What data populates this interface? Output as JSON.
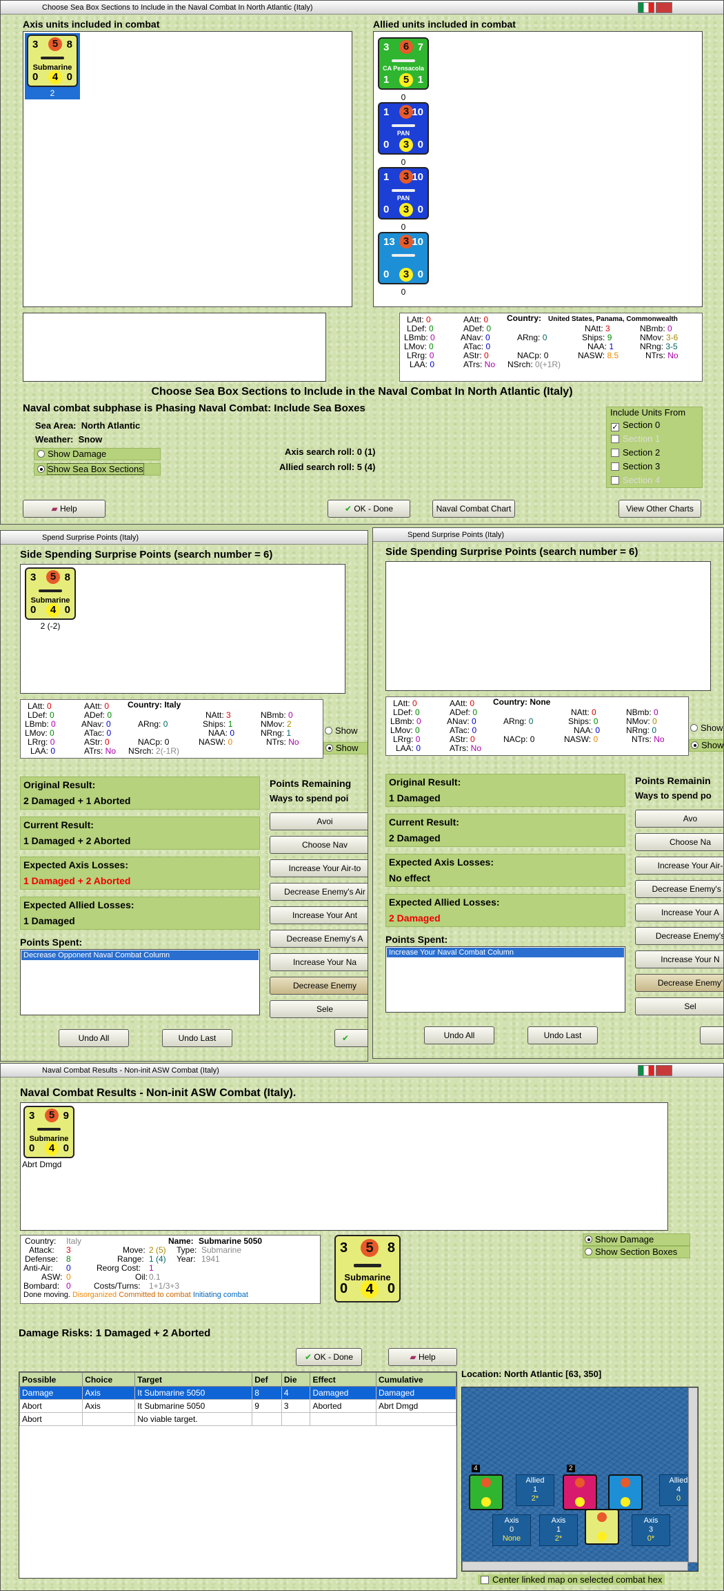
{
  "sea_box_window": {
    "title": "Choose Sea Box Sections to Include in the Naval Combat In North Atlantic (Italy)",
    "axis_units_label": "Axis units included in combat",
    "allied_units_label": "Allied units included in combat",
    "axis_unit": {
      "tl": "3",
      "tm": "5",
      "tr": "8",
      "name": "Submarine",
      "bl": "0",
      "bm": "4",
      "br": "0",
      "below": "2"
    },
    "allied_units": [
      {
        "tl": "3",
        "tm": "6",
        "tr": "7",
        "name": "CA Pensacola",
        "bl": "1",
        "bm": "5",
        "br": "1",
        "below": "0",
        "color": "#2fb52f"
      },
      {
        "tl": "1",
        "tm": "3",
        "tr": "10",
        "name": "PAN",
        "bl": "0",
        "bm": "3",
        "br": "0",
        "below": "0",
        "color": "#1c3fd6"
      },
      {
        "tl": "1",
        "tm": "3",
        "tr": "10",
        "name": "PAN",
        "bl": "0",
        "bm": "3",
        "br": "0",
        "below": "0",
        "color": "#1c3fd6"
      },
      {
        "tl": "13",
        "tm": "3",
        "tr": "10",
        "name": "",
        "bl": "0",
        "bm": "3",
        "br": "0",
        "below": "0",
        "color": "#1d8fd6"
      }
    ],
    "stats": {
      "latt": "0",
      "aatt": "0",
      "ldef": "0",
      "adef": "0",
      "lbmb": "0",
      "anav": "0",
      "lmov": "0",
      "atac": "0",
      "lrg": "0",
      "astr": "0",
      "laa": "0",
      "atrs": "No",
      "country_label": "Country:",
      "country": "United States, Panama, Commonwealth",
      "arng": "0",
      "nacp": "0",
      "nsrch": "0(+1R)",
      "natt": "3",
      "nbmb": "0",
      "ships": "9",
      "nmov": "3-6",
      "naa": "1",
      "nrng": "3-5",
      "nasw": "8.5",
      "ntrs": "No"
    },
    "heading": "Choose Sea Box Sections to Include in the Naval Combat In North Atlantic (Italy)",
    "subphase": "Naval combat subphase is Phasing Naval Combat: Include Sea Boxes",
    "sea_area_label": "Sea Area:",
    "sea_area": "North Atlantic",
    "weather_label": "Weather:",
    "weather": "Snow",
    "show_damage": "Show Damage",
    "show_sections": "Show Sea Box Sections",
    "axis_search": "Axis search roll: 0 (1)",
    "allied_search": "Allied search roll: 5 (4)",
    "include_from": "Include Units From",
    "sections": [
      "Section 0",
      "Section 1",
      "Section 2",
      "Section 3",
      "Section 4"
    ],
    "help": "Help",
    "ok": "OK - Done",
    "chart": "Naval Combat Chart",
    "other": "View Other Charts"
  },
  "surprise_left": {
    "title": "Spend Surprise Points (Italy)",
    "header": "Side Spending Surprise Points (search number = 6)",
    "unit": {
      "tl": "3",
      "tm": "5",
      "tr": "8",
      "name": "Submarine",
      "bl": "0",
      "bm": "4",
      "br": "0",
      "below": "2 (-2)"
    },
    "stats": {
      "latt": "0",
      "aatt": "0",
      "country_label": "Country:",
      "country": "Italy",
      "natt": "3",
      "nbmb": "0",
      "ldef": "0",
      "adef": "0",
      "ships": "1",
      "nmov": "2",
      "lbmb": "0",
      "anav": "0",
      "arng": "0",
      "naa": "0",
      "nrng": "1",
      "lmov": "0",
      "atac": "0",
      "nasw": "0",
      "ntrs": "No",
      "lrg": "0",
      "astr": "0",
      "nacp": "0",
      "laa": "0",
      "atrs": "No",
      "nsrch": "2(-1R)"
    },
    "orig_h": "Original Result:",
    "orig_v": "2 Damaged + 1 Aborted",
    "cur_h": "Current Result:",
    "cur_v": "1 Damaged + 2 Aborted",
    "axis_h": "Expected Axis Losses:",
    "axis_v": "1 Damaged + 2 Aborted",
    "allied_h": "Expected Allied Losses:",
    "allied_v": "1 Damaged",
    "spent_h": "Points Spent:",
    "spent_item": "Decrease Opponent Naval Combat Column",
    "remaining": "Points Remaining",
    "ways": "Ways to spend poi",
    "buttons": [
      "Avoi",
      "Choose Nav",
      "Increase Your Air-to",
      "Decrease Enemy's Air",
      "Increase Your Ant",
      "Decrease Enemy's A",
      "Increase Your Na",
      "Decrease Enemy",
      "Sele"
    ],
    "show1": "Show",
    "show2": "Show",
    "undo_all": "Undo All",
    "undo_last": "Undo Last"
  },
  "surprise_right": {
    "title": "Spend Surprise Points (Italy)",
    "header": "Side Spending Surprise Points (search number = 6)",
    "stats": {
      "latt": "0",
      "aatt": "0",
      "country_label": "Country:",
      "country": "None",
      "natt": "0",
      "nbmb": "0",
      "ldef": "0",
      "adef": "0",
      "ships": "0",
      "nmov": "0",
      "lbmb": "0",
      "anav": "0",
      "arng": "0",
      "naa": "0",
      "nrng": "0",
      "lmov": "0",
      "atac": "0",
      "nasw": "0",
      "ntrs": "No",
      "lrg": "0",
      "astr": "0",
      "nacp": "0",
      "laa": "0",
      "atrs": "No"
    },
    "orig_h": "Original Result:",
    "orig_v": "1 Damaged",
    "cur_h": "Current Result:",
    "cur_v": "2 Damaged",
    "axis_h": "Expected Axis Losses:",
    "axis_v": "No effect",
    "allied_h": "Expected Allied Losses:",
    "allied_v": "2 Damaged",
    "spent_h": "Points Spent:",
    "spent_item": "Increase Your Naval Combat Column",
    "remaining": "Points Remainin",
    "ways": "Ways to spend po",
    "buttons": [
      "Avo",
      "Choose Na",
      "Increase Your Air-",
      "Decrease Enemy's A",
      "Increase Your A",
      "Decrease Enemy's",
      "Increase Your N",
      "Decrease Enemy'",
      "Sel"
    ],
    "show1": "Show",
    "show2": "Show",
    "undo_all": "Undo All",
    "undo_last": "Undo Last"
  },
  "results_window": {
    "title": "Naval Combat Results - Non-init ASW Combat (Italy)",
    "heading": "Naval Combat Results - Non-init ASW Combat (Italy).",
    "unit": {
      "tl": "3",
      "tm": "5",
      "tr": "9",
      "name": "Submarine",
      "bl": "0",
      "bm": "4",
      "br": "0",
      "below": "Abrt Dmgd"
    },
    "big_unit": {
      "tl": "3",
      "tm": "5",
      "tr": "8",
      "name": "Submarine",
      "bl": "0",
      "bm": "4",
      "br": "0"
    },
    "info": {
      "country_l": "Country:",
      "country": "Italy",
      "attack_l": "Attack:",
      "attack": "3",
      "defense_l": "Defense:",
      "defense": "8",
      "antiair_l": "Anti-Air:",
      "antiair": "0",
      "asw_l": "ASW:",
      "asw": "0",
      "bombard_l": "Bombard:",
      "bombard": "0",
      "name_l": "Name:",
      "name": "Submarine 5050",
      "move_l": "Move:",
      "move": "2 (5)",
      "type_l": "Type:",
      "type": "Submarine",
      "range_l": "Range:",
      "range": "1 (4)",
      "year_l": "Year:",
      "year": "1941",
      "reorg_l": "Reorg Cost:",
      "reorg": "1",
      "oil_l": "Oil:",
      "oil": "0.1",
      "costs_l": "Costs/Turns:",
      "costs": "1+1/3+3",
      "status1": "Done moving.",
      "status2": "Disorganized",
      "status3": "Committed to combat",
      "status4": "Initiating combat"
    },
    "show_damage": "Show Damage",
    "show_sections": "Show Section Boxes",
    "risks": "Damage Risks:  1 Damaged + 2 Aborted",
    "ok": "OK - Done",
    "help": "Help",
    "table_headers": [
      "Possible",
      "Choice",
      "Target",
      "Def",
      "Die",
      "Effect",
      "Cumulative"
    ],
    "rows": [
      [
        "Damage",
        "Axis",
        "It Submarine 5050",
        "8",
        "4",
        "Damaged",
        "Damaged"
      ],
      [
        "Abort",
        "Axis",
        "It Submarine 5050",
        "9",
        "3",
        "Aborted",
        "Abrt Dmgd"
      ],
      [
        "Abort",
        "",
        "No viable target.",
        "",
        "",
        "",
        ""
      ]
    ],
    "location": "Location:  North Atlantic [63, 350]",
    "map_boxes": [
      {
        "a": "Allied",
        "b": "1",
        "c": "2*"
      },
      {
        "a": "Allied",
        "b": "4",
        "c": "0"
      },
      {
        "a": "Axis",
        "b": "0",
        "c": "None"
      },
      {
        "a": "Axis",
        "b": "1",
        "c": "2*"
      },
      {
        "a": "Axis",
        "b": "3",
        "c": "0*"
      }
    ],
    "map_counts": [
      "4",
      "2"
    ],
    "center_map": "Center linked map on selected combat hex"
  }
}
